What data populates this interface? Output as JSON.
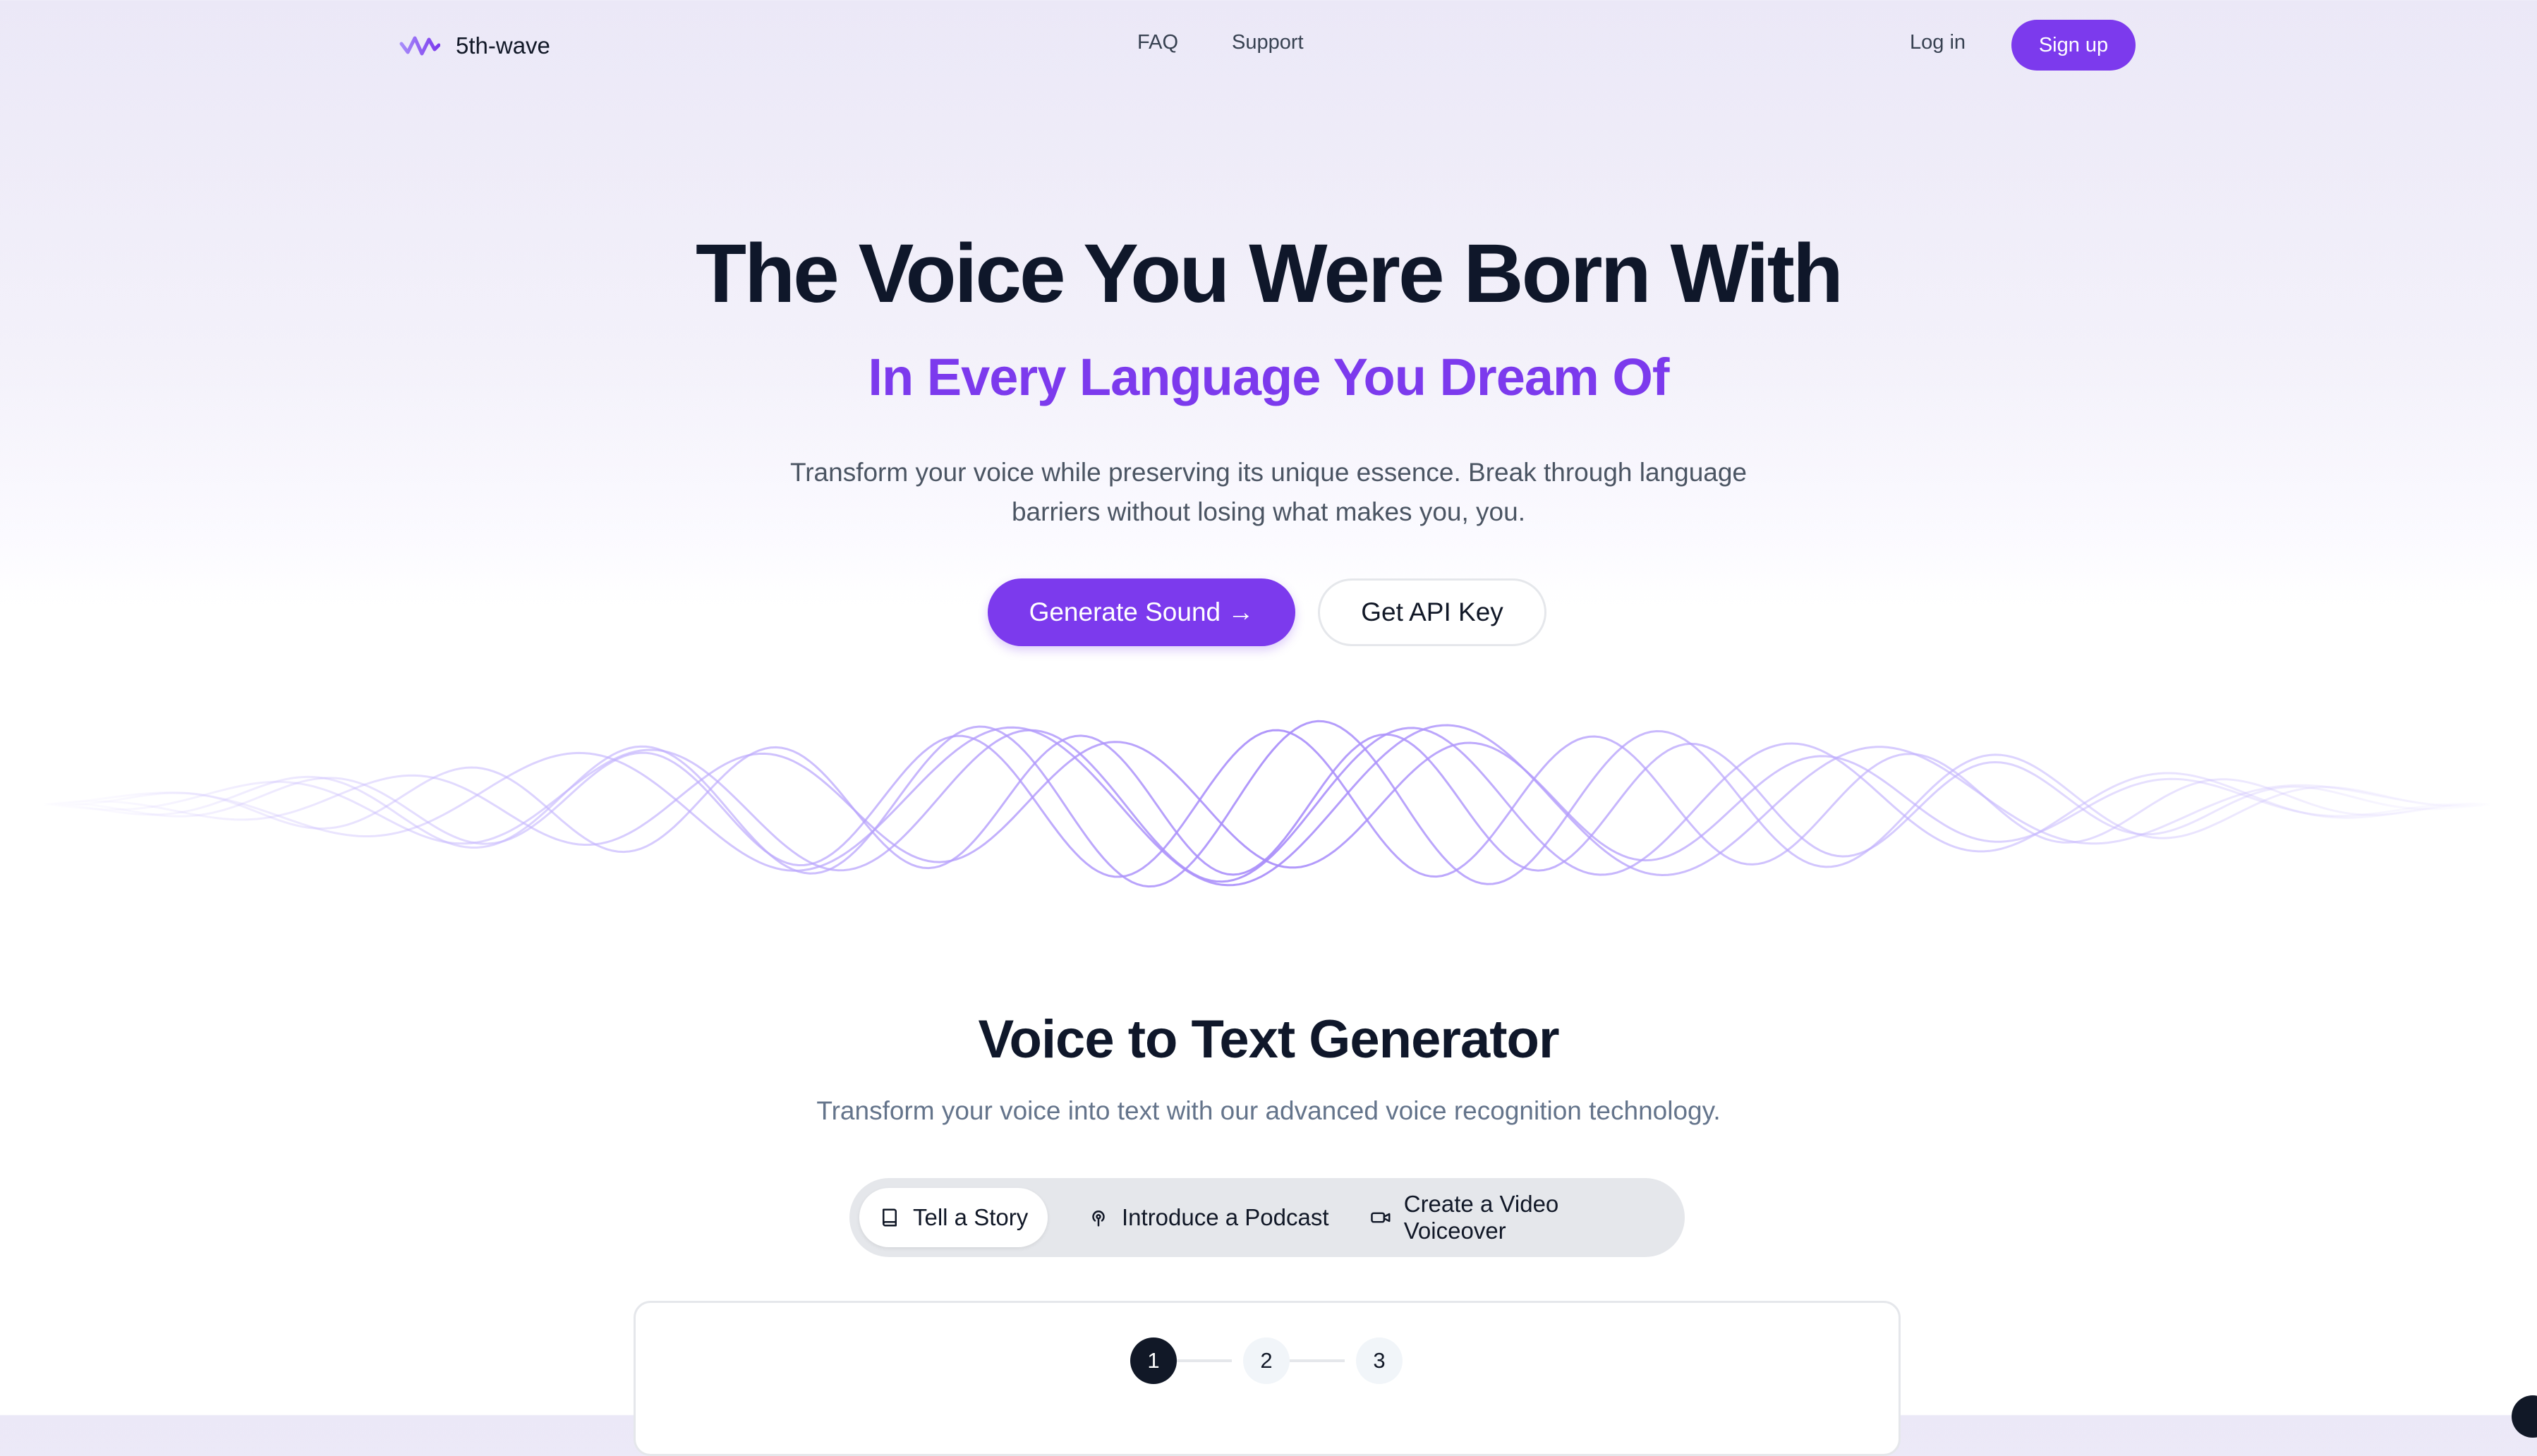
{
  "brand": {
    "name": "5th-wave"
  },
  "nav": {
    "links": [
      {
        "label": "FAQ"
      },
      {
        "label": "Support"
      }
    ],
    "login_label": "Log in",
    "signup_label": "Sign up"
  },
  "hero": {
    "title": "The Voice You Were Born With",
    "subtitle": "In Every Language You Dream Of",
    "description_line1": "Transform your voice while preserving its unique essence. Break through language",
    "description_line2": "barriers without losing what makes you, you.",
    "primary_button": "Generate Sound →",
    "secondary_button": "Get API Key"
  },
  "generator": {
    "title": "Voice to Text Generator",
    "description": "Transform your voice into text with our advanced voice recognition technology.",
    "tabs": [
      {
        "label": "Tell a Story",
        "icon": "book-icon",
        "active": true
      },
      {
        "label": "Introduce a Podcast",
        "icon": "podcast-icon",
        "active": false
      },
      {
        "label": "Create a Video Voiceover",
        "icon": "video-icon",
        "active": false
      }
    ],
    "steps": [
      {
        "label": "1",
        "active": true
      },
      {
        "label": "2",
        "active": false
      },
      {
        "label": "3",
        "active": false
      }
    ]
  },
  "colors": {
    "accent": "#7c3aed",
    "text_dark": "#0f172a",
    "muted": "#64748b"
  }
}
